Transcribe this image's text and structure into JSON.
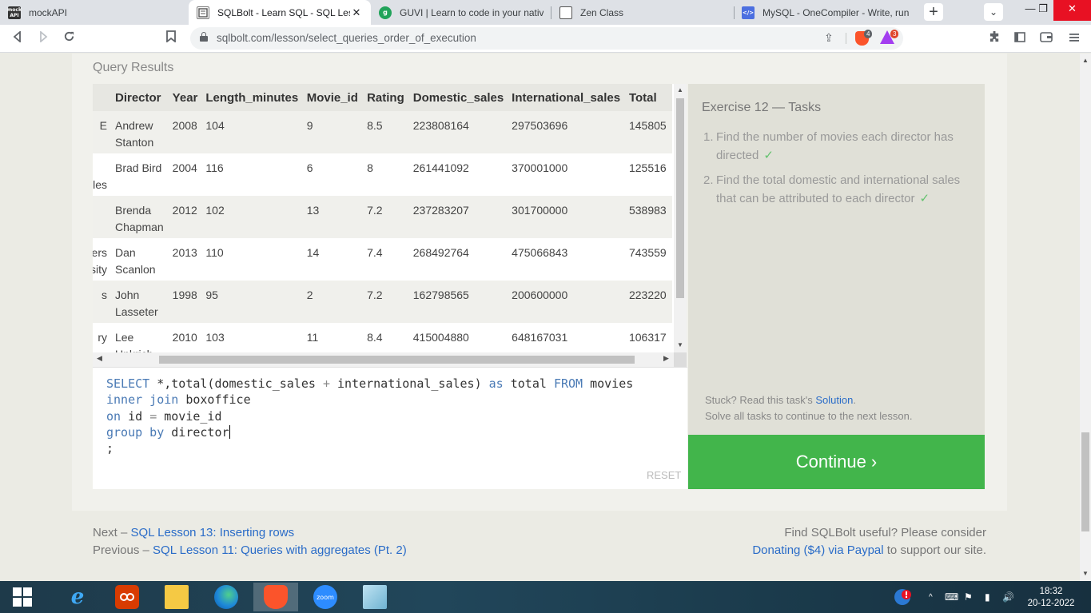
{
  "browser": {
    "tabs": [
      {
        "title": "mockAPI",
        "active": false
      },
      {
        "title": "SQLBolt - Learn SQL - SQL Lesson",
        "active": true
      },
      {
        "title": "GUVI | Learn to code in your native language",
        "active": false
      },
      {
        "title": "Zen Class",
        "active": false
      },
      {
        "title": "MySQL - OneCompiler - Write, run and share",
        "active": false
      }
    ],
    "favicon_text": {
      "mockapi": "mock API",
      "guvi": "g",
      "onecompiler": "</>"
    },
    "url": "sqlbolt.com/lesson/select_queries_order_of_execution",
    "brave_badge": "4",
    "rewards_badge": "3",
    "new_tab_symbol": "+",
    "window_controls": {
      "tabsearch": "⌄",
      "minimize": "—",
      "restore": "❐",
      "close": "✕"
    }
  },
  "query_results": {
    "label": "Query Results",
    "columns": [
      "",
      "Director",
      "Year",
      "Length_minutes",
      "Movie_id",
      "Rating",
      "Domestic_sales",
      "International_sales",
      "Total"
    ],
    "rows": [
      [
        "E",
        "Andrew Stanton",
        "2008",
        "104",
        "9",
        "8.5",
        "223808164",
        "297503696",
        "145805"
      ],
      [
        "bles",
        "Brad Bird",
        "2004",
        "116",
        "6",
        "8",
        "261441092",
        "370001000",
        "125516"
      ],
      [
        "",
        "Brenda Chapman",
        "2012",
        "102",
        "13",
        "7.2",
        "237283207",
        "301700000",
        "538983"
      ],
      [
        "ers sity",
        "Dan Scanlon",
        "2013",
        "110",
        "14",
        "7.4",
        "268492764",
        "475066843",
        "743559"
      ],
      [
        "s",
        "John Lasseter",
        "1998",
        "95",
        "2",
        "7.2",
        "162798565",
        "200600000",
        "223220"
      ],
      [
        "ry",
        "Lee Unkrich",
        "2010",
        "103",
        "11",
        "8.4",
        "415004880",
        "648167031",
        "106317"
      ]
    ]
  },
  "editor": {
    "line1": {
      "k1": "SELECT",
      "t1": " *,total(domestic_sales ",
      "op1": "+",
      "t2": " international_sales) ",
      "k2": "as",
      "t3": " total ",
      "k3": "FROM",
      "t4": " movies"
    },
    "line2": {
      "k1": "inner join",
      "t1": " boxoffice"
    },
    "line3": {
      "k1": "on",
      "t1": " id ",
      "op1": "=",
      "t2": " movie_id"
    },
    "line4": {
      "k1": "group by",
      "t1": " director"
    },
    "line5": ";",
    "reset_label": "RESET"
  },
  "tasks": {
    "title": "Exercise 12 — Tasks",
    "items": [
      {
        "num": "1.",
        "text": "Find the number of movies each director has directed",
        "check": "✓"
      },
      {
        "num": "2.",
        "text": "Find the total domestic and international sales that can be attributed to each director",
        "check": "✓"
      }
    ],
    "stuck_prefix": "Stuck? Read this task's ",
    "solution_link": "Solution",
    "stuck_suffix": ".",
    "solve_all": "Solve all tasks to continue to the next lesson.",
    "continue_label": "Continue ›"
  },
  "footer": {
    "next_prefix": "Next – ",
    "next_link": "SQL Lesson 13: Inserting rows",
    "prev_prefix": "Previous – ",
    "prev_link": "SQL Lesson 11: Queries with aggregates (Pt. 2)",
    "useful": "Find SQLBolt useful? Please consider",
    "donate_link": "Donating ($4) via Paypal",
    "donate_suffix": " to support our site."
  },
  "taskbar": {
    "zoom_label": "zoom",
    "tray_icons": [
      "^",
      "⌨",
      "⚑",
      "▮",
      "🔊"
    ],
    "time": "18:32",
    "date": "20-12-2022"
  },
  "colors": {
    "continue": "#42b54b",
    "link": "#2a6cc8",
    "keyword": "#4a7ab5",
    "check": "#63c26e"
  }
}
